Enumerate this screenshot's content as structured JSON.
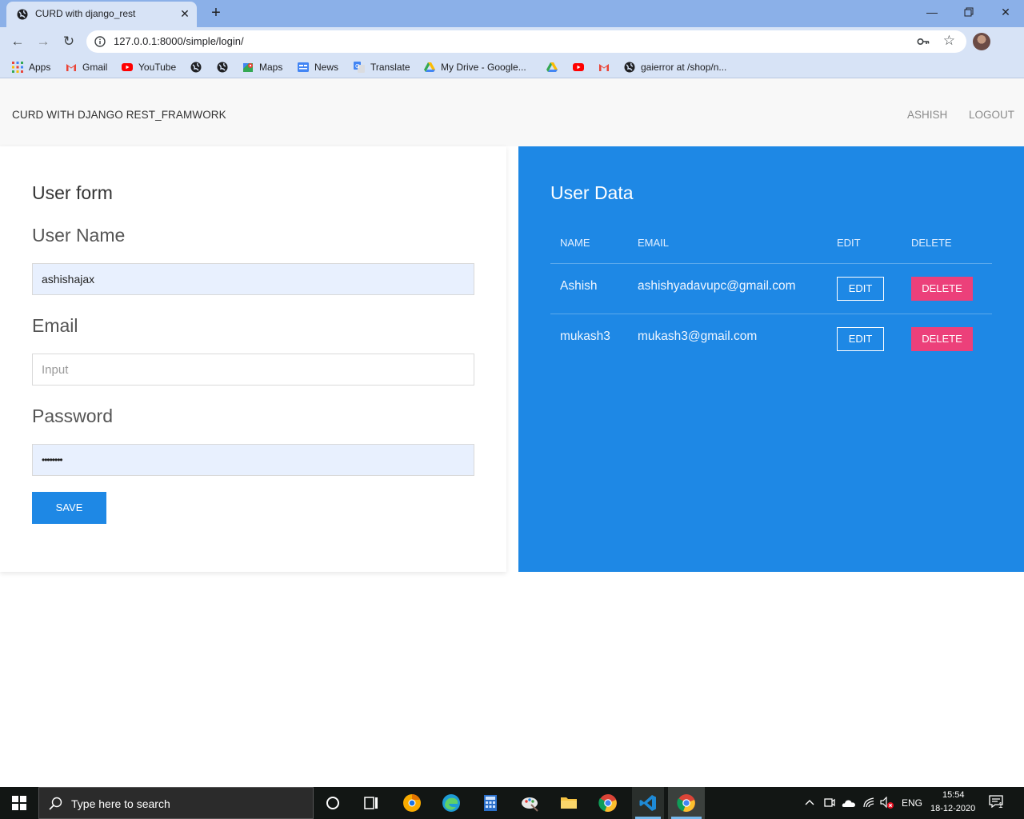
{
  "browser": {
    "tab_title": "CURD with django_rest",
    "url": "127.0.0.1:8000/simple/login/",
    "bookmarks": [
      {
        "label": "Apps",
        "icon": "apps-grid-icon"
      },
      {
        "label": "Gmail",
        "icon": "gmail-icon"
      },
      {
        "label": "YouTube",
        "icon": "youtube-icon"
      },
      {
        "label": "",
        "icon": "globe-icon"
      },
      {
        "label": "",
        "icon": "globe-icon"
      },
      {
        "label": "Maps",
        "icon": "maps-icon"
      },
      {
        "label": "News",
        "icon": "news-icon"
      },
      {
        "label": "Translate",
        "icon": "translate-icon"
      },
      {
        "label": "My Drive - Google...",
        "icon": "drive-icon"
      },
      {
        "label": "",
        "icon": "drive-icon"
      },
      {
        "label": "",
        "icon": "youtube-icon"
      },
      {
        "label": "",
        "icon": "gmail-icon"
      },
      {
        "label": "gaierror at /shop/n...",
        "icon": "globe-icon"
      }
    ]
  },
  "navbar": {
    "brand": "CURD WITH DJANGO REST_FRAMWORK",
    "user": "ASHISH",
    "logout": "LOGOUT"
  },
  "form": {
    "title": "User form",
    "username_label": "User Name",
    "username_value": "ashishajax",
    "email_label": "Email",
    "email_placeholder": "Input",
    "password_label": "Password",
    "password_value": "••••••••",
    "save_label": "SAVE"
  },
  "user_data": {
    "title": "User Data",
    "headers": [
      "NAME",
      "EMAIL",
      "EDIT",
      "DELETE"
    ],
    "rows": [
      {
        "name": "Ashish",
        "email": "ashishyadavupc@gmail.com",
        "edit": "EDIT",
        "delete": "DELETE"
      },
      {
        "name": "mukash3",
        "email": "mukash3@gmail.com",
        "edit": "EDIT",
        "delete": "DELETE"
      }
    ]
  },
  "taskbar": {
    "search_placeholder": "Type here to search",
    "language": "ENG",
    "time": "15:54",
    "date": "18-12-2020",
    "notification_count": "1"
  },
  "colors": {
    "primary": "#1e88e5",
    "danger": "#ec407a",
    "navbar_bg": "#f8f8f8"
  }
}
